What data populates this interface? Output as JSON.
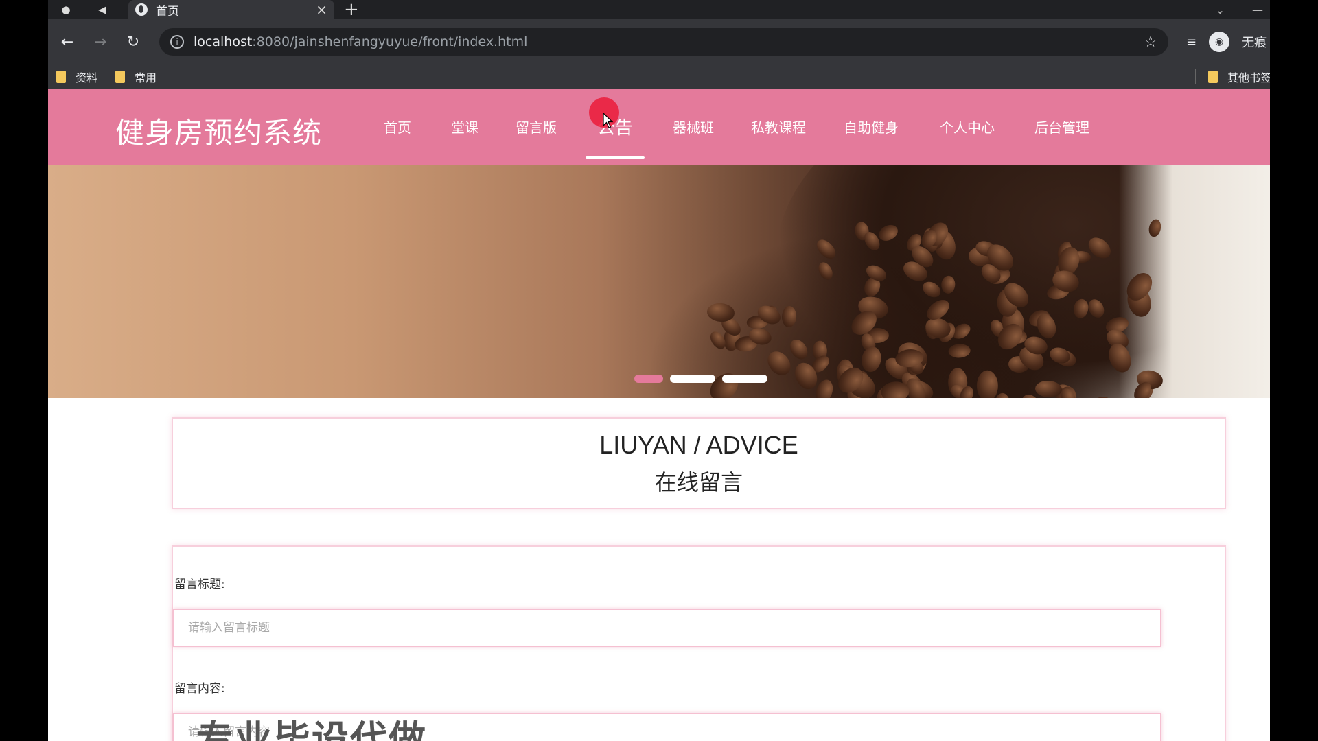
{
  "browser": {
    "tab_title": "首页",
    "tab_close": "×",
    "tab_new": "+",
    "url_host": "localhost",
    "url_path": ":8080/jainshenfangyuyue/front/index.html",
    "profile_label": "无痕",
    "bookmarks": [
      {
        "label": "资料"
      },
      {
        "label": "常用"
      }
    ],
    "other_bookmarks": "其他书签"
  },
  "site": {
    "title": "健身房预约系统",
    "nav": [
      {
        "label": "首页"
      },
      {
        "label": "堂课"
      },
      {
        "label": "留言版"
      },
      {
        "label": "公告"
      },
      {
        "label": "器械班"
      },
      {
        "label": "私教课程"
      },
      {
        "label": "自助健身"
      },
      {
        "label": "个人中心"
      },
      {
        "label": "后台管理"
      }
    ],
    "active_nav": "公告",
    "carousel": {
      "slide_count": 3,
      "active_index": 0
    }
  },
  "section": {
    "title_en": "LIUYAN / ADVICE",
    "title_cn": "在线留言"
  },
  "form": {
    "title_label": "留言标题:",
    "title_placeholder": "请输入留言标题",
    "content_label": "留言内容:",
    "content_placeholder": "请输入留言内容"
  },
  "overlay": {
    "text": "专业毕设代做"
  },
  "colors": {
    "header": "#e47a9b",
    "accent_border": "#f7cfdc",
    "click_indicator": "#eb1e3c"
  }
}
